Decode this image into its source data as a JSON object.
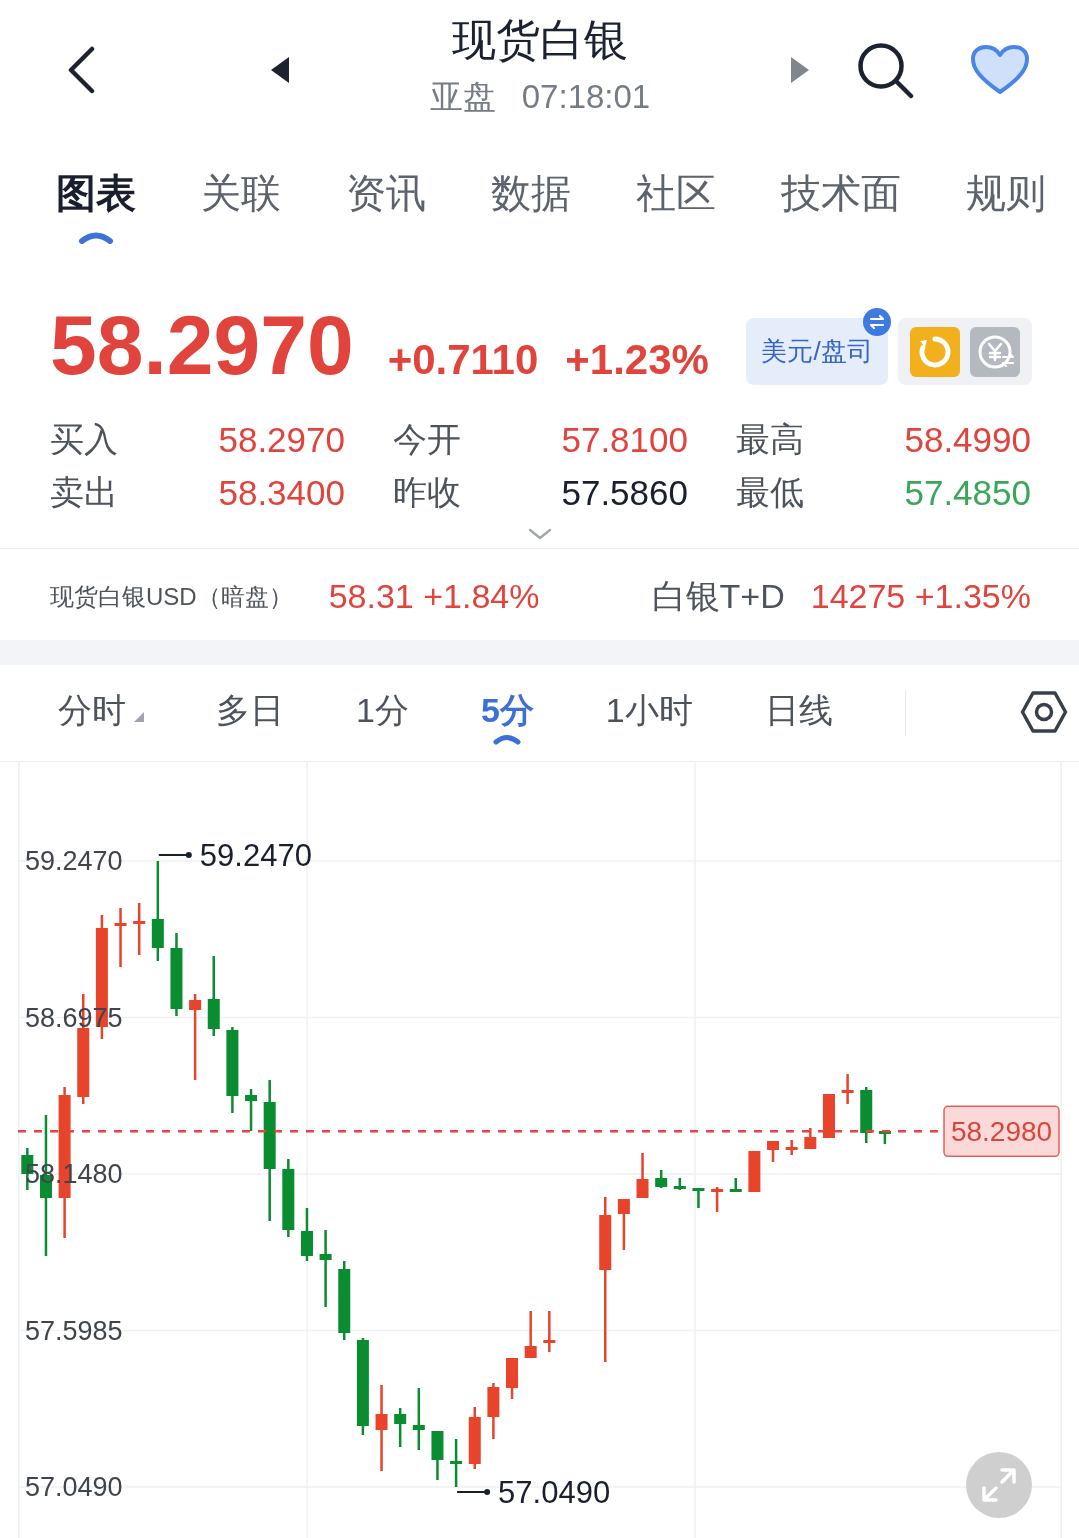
{
  "header": {
    "title": "现货白银",
    "session": "亚盘",
    "time": "07:18:01",
    "prev_button": {
      "disabled": false
    },
    "next_button": {
      "disabled": true
    },
    "favorited": true
  },
  "tabs": [
    {
      "label": "图表",
      "selected": true
    },
    {
      "label": "关联",
      "selected": false
    },
    {
      "label": "资讯",
      "selected": false
    },
    {
      "label": "数据",
      "selected": false
    },
    {
      "label": "社区",
      "selected": false
    },
    {
      "label": "技术面",
      "selected": false
    },
    {
      "label": "规则",
      "selected": false
    }
  ],
  "quote": {
    "price": "58.2970",
    "change": "+0.7110",
    "change_percent": "+1.23%",
    "unit_button": "美元/盘司"
  },
  "stats": [
    {
      "label": "买入",
      "value": "58.2970",
      "color": "#e0443c"
    },
    {
      "label": "今开",
      "value": "57.8100",
      "color": "#e0443c"
    },
    {
      "label": "最高",
      "value": "58.4990",
      "color": "#e0443c"
    },
    {
      "label": "卖出",
      "value": "58.3400",
      "color": "#e0443c"
    },
    {
      "label": "昨收",
      "value": "57.5860",
      "color": "#1a1f2e"
    },
    {
      "label": "最低",
      "value": "57.4850",
      "color": "#3aa657"
    }
  ],
  "related": [
    {
      "name": "现货白银USD（暗盘）",
      "quote": "58.31 +1.84%"
    },
    {
      "name": "白银T+D",
      "quote": "14275 +1.35%"
    }
  ],
  "periods": [
    {
      "label": "分时",
      "selected": false,
      "has_menu": true
    },
    {
      "label": "多日",
      "selected": false,
      "has_menu": false
    },
    {
      "label": "1分",
      "selected": false,
      "has_menu": false
    },
    {
      "label": "5分",
      "selected": true,
      "has_menu": false
    },
    {
      "label": "1小时",
      "selected": false,
      "has_menu": false
    },
    {
      "label": "日线",
      "selected": false,
      "has_menu": false
    }
  ],
  "chart": {
    "chart_data": {
      "type": "candlestick",
      "grid": true,
      "categories": [
        null,
        null,
        null,
        null,
        null,
        null,
        null,
        null,
        null,
        null,
        null,
        null,
        null,
        null,
        null,
        null,
        null,
        null,
        null,
        null,
        null,
        null,
        null,
        null,
        null,
        null,
        null,
        null,
        null,
        null,
        null,
        null,
        null,
        null,
        null,
        null,
        null,
        null,
        null,
        null,
        null,
        null,
        null,
        null,
        null,
        null,
        null,
        null,
        null,
        null,
        null,
        null,
        null,
        null,
        null,
        null
      ],
      "ohlc": [
        [
          58.2147,
          58.2393,
          58.0918,
          58.148
        ],
        [
          58.1445,
          58.3552,
          57.8601,
          58.0638
        ],
        [
          58.0638,
          58.4535,
          57.9233,
          58.4254
        ],
        [
          58.4184,
          58.78,
          58.3938,
          58.6606
        ],
        [
          58.6642,
          59.0574,
          58.622,
          59.0118
        ],
        [
          59.0188,
          59.082,
          58.8748,
          59.0293
        ],
        [
          59.0258,
          59.0995,
          58.917,
          59.0363
        ],
        [
          59.0434,
          59.247,
          58.8959,
          58.9415
        ],
        [
          58.9415,
          58.9942,
          58.7028,
          58.7274
        ],
        [
          58.7238,
          58.78,
          58.4781,
          58.759
        ],
        [
          58.7625,
          58.9134,
          58.6326,
          58.6571
        ],
        [
          58.6536,
          58.6642,
          58.3622,
          58.4219
        ],
        [
          58.4254,
          58.4465,
          58.299,
          58.4043
        ],
        [
          58.4008,
          58.4781,
          57.983,
          58.1656
        ],
        [
          58.1656,
          58.2007,
          57.9268,
          57.9514
        ],
        [
          57.9479,
          58.0286,
          57.8426,
          57.8601
        ],
        [
          57.8671,
          57.9514,
          57.6811,
          57.8461
        ],
        [
          57.8145,
          57.8426,
          57.5652,
          57.5898
        ],
        [
          57.5652,
          57.5722,
          57.2316,
          57.2632
        ],
        [
          57.2492,
          57.4072,
          57.1052,
          57.3054
        ],
        [
          57.3054,
          57.3264,
          57.1895,
          57.2703
        ],
        [
          57.2667,
          57.3967,
          57.179,
          57.2492
        ],
        [
          57.2457,
          57.2457,
          57.0736,
          57.1439
        ],
        [
          57.1403,
          57.2176,
          57.049,
          57.1298
        ],
        [
          57.1298,
          57.3299,
          57.1123,
          57.2948
        ],
        [
          57.2948,
          57.4142,
          57.2176,
          57.4002
        ],
        [
          57.3967,
          57.502,
          57.358,
          57.502
        ],
        [
          57.502,
          57.667,
          57.502,
          57.5441
        ],
        [
          57.5547,
          57.667,
          57.5231,
          57.5652
        ],
        null,
        null,
        [
          57.811,
          58.0673,
          57.4879,
          58.0041
        ],
        [
          58.0076,
          58.0602,
          57.8812,
          58.0602
        ],
        [
          58.0638,
          58.2218,
          58.0638,
          58.1305
        ],
        [
          58.134,
          58.1621,
          58.0989,
          58.1024
        ],
        [
          58.1059,
          58.134,
          58.0918,
          58.0954
        ],
        [
          58.0989,
          58.0989,
          58.0286,
          58.0883
        ],
        [
          58.0883,
          58.1024,
          58.0146,
          58.0954
        ],
        [
          58.0954,
          58.134,
          58.0848,
          58.0848
        ],
        [
          58.0848,
          58.2288,
          58.0848,
          58.2288
        ],
        [
          58.2323,
          58.2639,
          58.1902,
          58.2639
        ],
        [
          58.2358,
          58.2674,
          58.2147,
          58.2428
        ],
        [
          58.2358,
          58.3095,
          58.2358,
          58.2779
        ],
        [
          58.2744,
          58.4289,
          58.2744,
          58.4289
        ],
        [
          58.4359,
          58.499,
          58.3938,
          58.443
        ],
        [
          58.443,
          58.4535,
          58.2569,
          58.292
        ],
        [
          58.299,
          58.299,
          58.2534,
          58.298
        ],
        null,
        null,
        null,
        null,
        null,
        null,
        null,
        null,
        null
      ],
      "ylim": [
        56.87,
        59.5946
      ],
      "yticks": [
        {
          "value": 59.247,
          "label": "59.2470"
        },
        {
          "value": 58.6975,
          "label": "58.6975"
        },
        {
          "value": 58.148,
          "label": "58.1480"
        },
        {
          "value": 57.5985,
          "label": "57.5985"
        },
        {
          "value": 57.049,
          "label": "57.0490"
        }
      ],
      "ref_lines": [
        {
          "axis": "y",
          "value": 58.298,
          "label": "58.2980"
        }
      ]
    },
    "high_label": "59.2470",
    "low_label": "57.0490"
  }
}
